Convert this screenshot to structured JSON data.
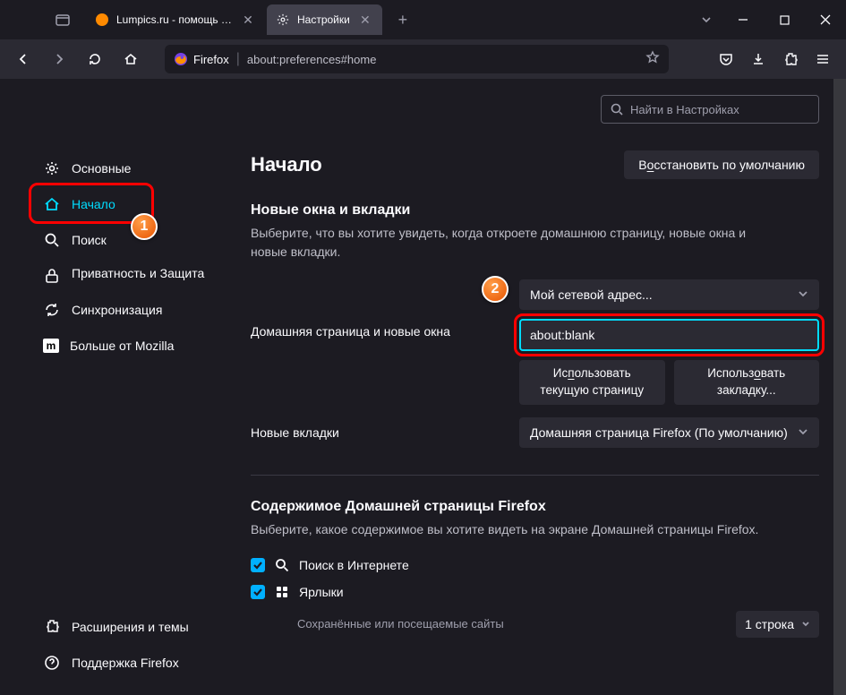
{
  "tabs": {
    "inactive": {
      "label": "Lumpics.ru - помощь с компьютером"
    },
    "active": {
      "label": "Настройки"
    }
  },
  "urlbar": {
    "identity": "Firefox",
    "url": "about:preferences#home"
  },
  "search": {
    "placeholder": "Найти в Настройках"
  },
  "sidebar": {
    "general": "Основные",
    "home": "Начало",
    "search": "Поиск",
    "privacy": "Приватность и Защита",
    "sync": "Синхронизация",
    "more": "Больше от Mozilla",
    "extensions": "Расширения и темы",
    "support": "Поддержка Firefox"
  },
  "badge1": "1",
  "badge2": "2",
  "main": {
    "title": "Начало",
    "restore": "Восстановить по умолчанию",
    "section1_title": "Новые окна и вкладки",
    "section1_desc": "Выберите, что вы хотите увидеть, когда откроете домашнюю страницу, новые окна и новые вкладки.",
    "row1_label": "Домашняя страница и новые окна",
    "select1": "Мой сетевой адрес...",
    "input_value": "about:blank",
    "btn_current": "Использовать текущую страницу",
    "btn_bookmark": "Использовать закладку...",
    "row2_label": "Новые вкладки",
    "select2": "Домашняя страница Firefox (По умолчанию)",
    "section2_title": "Содержимое Домашней страницы Firefox",
    "section2_desc": "Выберите, какое содержимое вы хотите видеть на экране Домашней страницы Firefox.",
    "chk1": "Поиск в Интернете",
    "chk2": "Ярлыки",
    "chk2_desc": "Сохранённые или посещаемые сайты",
    "chk2_count": "1 строка"
  }
}
